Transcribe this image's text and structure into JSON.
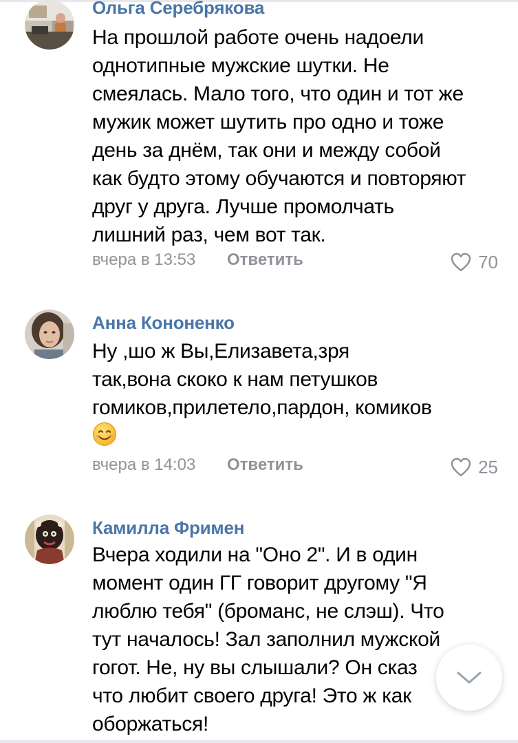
{
  "comments": [
    {
      "author": "Ольга Серебрякова",
      "avatar_icon": "user-avatar-photo",
      "lines": [
        "На прошлой работе очень надоели",
        "однотипные мужские шутки. Не",
        "смеялась. Мало того, что один и тот же",
        "мужик может шутить про одно и тоже",
        "день за днём, так они и между собой",
        "как будто этому обучаются и повторяют",
        "друг у друга. Лучше промолчать",
        "лишний раз, чем вот так."
      ],
      "date": "вчера в 13:53",
      "reply_label": "Ответить",
      "likes": "70"
    },
    {
      "author": "Анна Кононенко",
      "avatar_icon": "user-avatar-photo",
      "lines": [
        "Ну ,шо ж Вы,Елизавета,зря",
        "так,вона скоко к нам петушков",
        "гомиков,прилетело,пардон, комиков"
      ],
      "emoji_icon": "smiling-face-emoji",
      "date": "вчера в 14:03",
      "reply_label": "Ответить",
      "likes": "25"
    },
    {
      "author": "Камилла Фримен",
      "avatar_icon": "user-avatar-drawing",
      "lines": [
        "Вчера ходили на \"Оно 2\". И в один",
        "момент один ГГ говорит другому \"Я",
        "люблю тебя\" (броманс, не слэш). Что",
        "тут началось! Зал заполнил мужской",
        "гогот. Не, ну вы слышали? Он сказ",
        "что любит своего друга! Это ж как",
        "оборжаться!"
      ]
    }
  ],
  "colors": {
    "author": "#4a76a8",
    "meta": "#939393",
    "heart": "#8f9399"
  },
  "scroll_button_icon": "chevron-down-icon"
}
